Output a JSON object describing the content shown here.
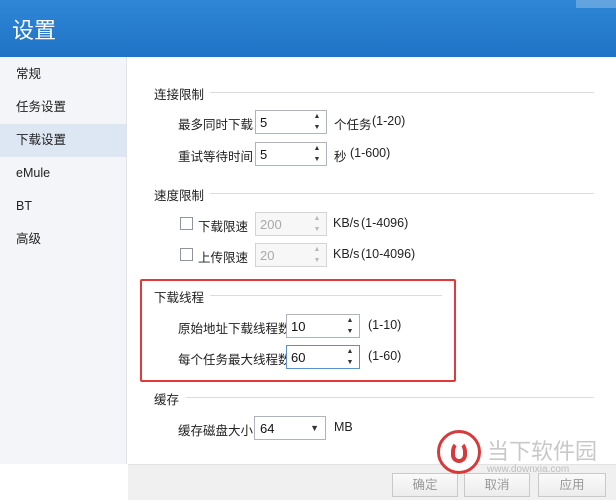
{
  "window": {
    "title": "设置"
  },
  "sidebar": {
    "items": [
      {
        "label": "常规"
      },
      {
        "label": "任务设置"
      },
      {
        "label": "下载设置"
      },
      {
        "label": "eMule"
      },
      {
        "label": "BT"
      },
      {
        "label": "高级"
      }
    ],
    "active_index": 2
  },
  "connection": {
    "title": "连接限制",
    "max_tasks": {
      "label": "最多同时下载",
      "value": "5",
      "unit": "个任务",
      "hint": "(1-20)"
    },
    "retry_wait": {
      "label": "重试等待时间",
      "value": "5",
      "unit": "秒",
      "hint": "(1-600)"
    }
  },
  "speed": {
    "title": "速度限制",
    "download": {
      "label": "下载限速",
      "value": "200",
      "unit": "KB/s",
      "hint": "(1-4096)",
      "checked": false
    },
    "upload": {
      "label": "上传限速",
      "value": "20",
      "unit": "KB/s",
      "hint": "(10-4096)",
      "checked": false
    }
  },
  "threads": {
    "title": "下载线程",
    "origin": {
      "label": "原始地址下载线程数",
      "value": "10",
      "hint": "(1-10)"
    },
    "per_task": {
      "label": "每个任务最大线程数",
      "value": "60",
      "hint": "(1-60)"
    }
  },
  "cache": {
    "title": "缓存",
    "disk": {
      "label": "缓存磁盘大小",
      "value": "64",
      "unit": "MB"
    }
  },
  "buttons": {
    "ok": "确定",
    "cancel": "取消",
    "apply": "应用"
  },
  "watermark": {
    "text": "当下软件园",
    "url": "www.downxia.com"
  },
  "colors": {
    "title_bar": "#2a7fd2",
    "highlight_border": "#e23a3a",
    "active_nav": "#dde7f3"
  }
}
